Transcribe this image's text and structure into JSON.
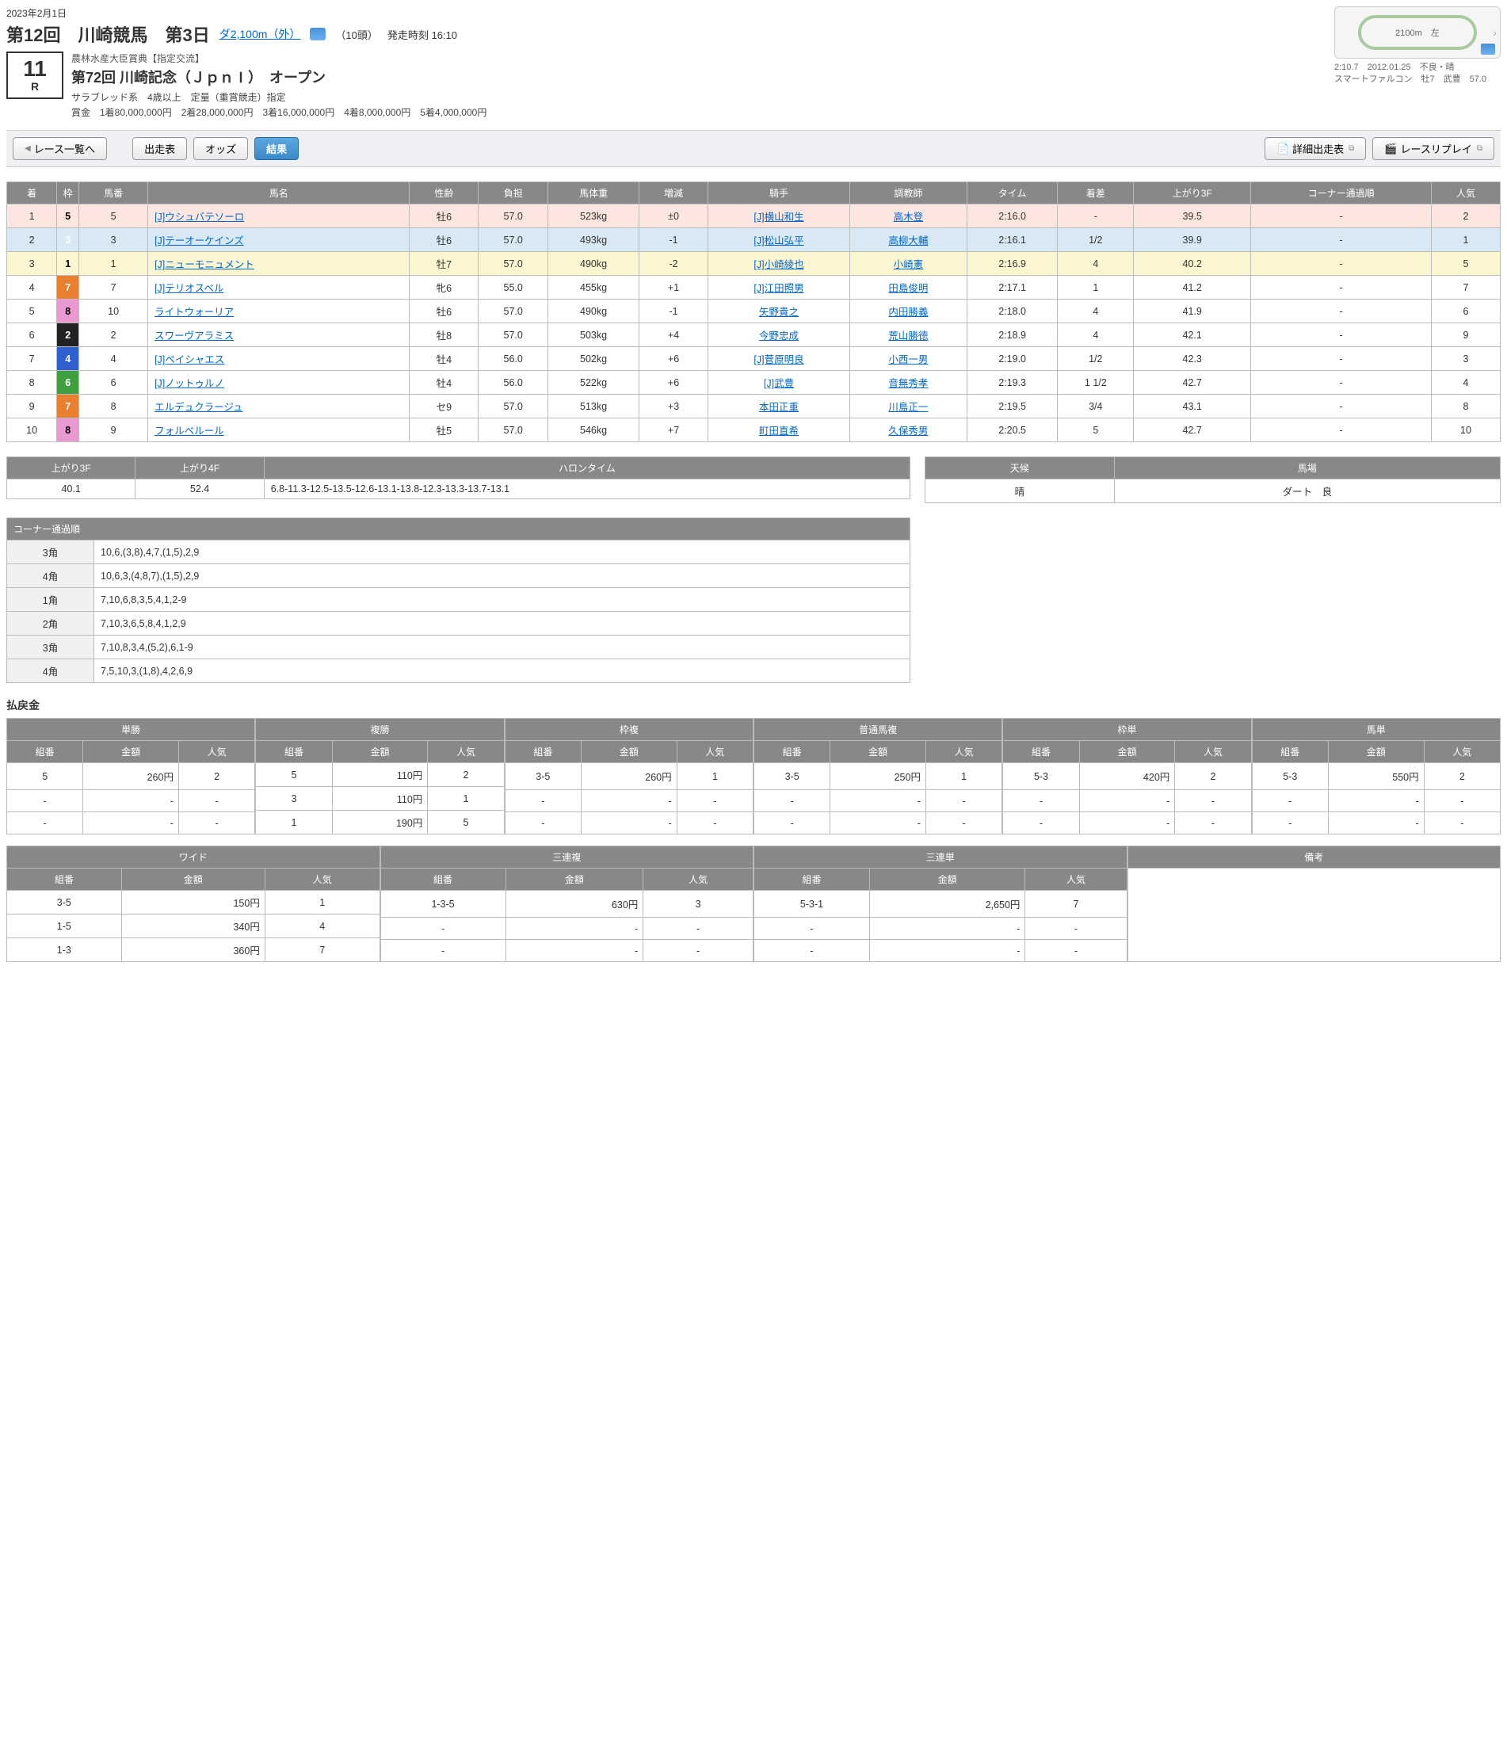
{
  "header": {
    "date": "2023年2月1日",
    "meeting": "第12回　川崎競馬　第3日",
    "course": "ダ2,100m（外）",
    "heads": "（10頭）",
    "start": "発走時刻 16:10",
    "race_no": "11",
    "race_r": "R",
    "subtitle": "農林水産大臣賞典【指定交流】",
    "race_name": "第72回 川崎記念（ＪｐｎⅠ）　オープン",
    "meta1": "サラブレッド系　4歳以上　定量（重賞競走）指定",
    "meta2": "賞金　1着80,000,000円　2着28,000,000円　3着16,000,000円　4着8,000,000円　5着4,000,000円",
    "track_label": "2100m　左",
    "rec1": "2:10.7　2012.01.25　不良・晴",
    "rec2": "スマートファルコン　牡7　武豊　57.0"
  },
  "nav": {
    "back": "レース一覧へ",
    "entry": "出走表",
    "odds": "オッズ",
    "result": "結果",
    "detail": "詳細出走表",
    "replay": "レースリプレイ"
  },
  "results": {
    "head": [
      "着",
      "枠",
      "馬番",
      "馬名",
      "性齢",
      "負担",
      "馬体重",
      "増減",
      "騎手",
      "調教師",
      "タイム",
      "着差",
      "上がり3F",
      "コーナー通過順",
      "人気"
    ],
    "rows": [
      {
        "p": "1",
        "waku": "5",
        "wc": "w5",
        "num": "5",
        "name": "[J]ウシュバテソーロ",
        "sa": "牡6",
        "wt": "57.0",
        "bw": "523kg",
        "delta": "±0",
        "jk": "[J]横山和生",
        "tr": "高木登",
        "time": "2:16.0",
        "gap": "-",
        "u3f": "39.5",
        "corner": "-",
        "pop": "2",
        "nl": 1,
        "jl": 1,
        "tl": 1
      },
      {
        "p": "2",
        "waku": "3",
        "wc": "w3",
        "num": "3",
        "name": "[J]テーオーケインズ",
        "sa": "牡6",
        "wt": "57.0",
        "bw": "493kg",
        "delta": "-1",
        "jk": "[J]松山弘平",
        "tr": "高柳大輔",
        "time": "2:16.1",
        "gap": "1/2",
        "u3f": "39.9",
        "corner": "-",
        "pop": "1",
        "nl": 1,
        "jl": 1,
        "tl": 1
      },
      {
        "p": "3",
        "waku": "1",
        "wc": "w1",
        "num": "1",
        "name": "[J]ニューモニュメント",
        "sa": "牡7",
        "wt": "57.0",
        "bw": "490kg",
        "delta": "-2",
        "jk": "[J]小崎綾也",
        "tr": "小崎憲",
        "time": "2:16.9",
        "gap": "4",
        "u3f": "40.2",
        "corner": "-",
        "pop": "5",
        "nl": 1,
        "jl": 1,
        "tl": 1
      },
      {
        "p": "4",
        "waku": "7",
        "wc": "w7",
        "num": "7",
        "name": "[J]テリオスベル",
        "sa": "牝6",
        "wt": "55.0",
        "bw": "455kg",
        "delta": "+1",
        "jk": "[J]江田照男",
        "tr": "田島俊明",
        "time": "2:17.1",
        "gap": "1",
        "u3f": "41.2",
        "corner": "-",
        "pop": "7",
        "nl": 1,
        "jl": 1,
        "tl": 1
      },
      {
        "p": "5",
        "waku": "8",
        "wc": "w8",
        "num": "10",
        "name": "ライトウォーリア",
        "sa": "牡6",
        "wt": "57.0",
        "bw": "490kg",
        "delta": "-1",
        "jk": "矢野貴之",
        "tr": "内田勝義",
        "time": "2:18.0",
        "gap": "4",
        "u3f": "41.9",
        "corner": "-",
        "pop": "6",
        "nl": 1,
        "jl": 1,
        "tl": 1
      },
      {
        "p": "6",
        "waku": "2",
        "wc": "w2",
        "num": "2",
        "name": "スワーヴアラミス",
        "sa": "牡8",
        "wt": "57.0",
        "bw": "503kg",
        "delta": "+4",
        "jk": "今野忠成",
        "tr": "荒山勝徳",
        "time": "2:18.9",
        "gap": "4",
        "u3f": "42.1",
        "corner": "-",
        "pop": "9",
        "nl": 1,
        "jl": 1,
        "tl": 1
      },
      {
        "p": "7",
        "waku": "4",
        "wc": "w4",
        "num": "4",
        "name": "[J]ペイシャエス",
        "sa": "牡4",
        "wt": "56.0",
        "bw": "502kg",
        "delta": "+6",
        "jk": "[J]菅原明良",
        "tr": "小西一男",
        "time": "2:19.0",
        "gap": "1/2",
        "u3f": "42.3",
        "corner": "-",
        "pop": "3",
        "nl": 1,
        "jl": 1,
        "tl": 1
      },
      {
        "p": "8",
        "waku": "6",
        "wc": "w6",
        "num": "6",
        "name": "[J]ノットゥルノ",
        "sa": "牡4",
        "wt": "56.0",
        "bw": "522kg",
        "delta": "+6",
        "jk": "[J]武豊",
        "tr": "音無秀孝",
        "time": "2:19.3",
        "gap": "1 1/2",
        "u3f": "42.7",
        "corner": "-",
        "pop": "4",
        "nl": 1,
        "jl": 1,
        "tl": 1
      },
      {
        "p": "9",
        "waku": "7",
        "wc": "w7",
        "num": "8",
        "name": "エルデュクラージュ",
        "sa": "セ9",
        "wt": "57.0",
        "bw": "513kg",
        "delta": "+3",
        "jk": "本田正重",
        "tr": "川島正一",
        "time": "2:19.5",
        "gap": "3/4",
        "u3f": "43.1",
        "corner": "-",
        "pop": "8",
        "nl": 1,
        "jl": 1,
        "tl": 1
      },
      {
        "p": "10",
        "waku": "8",
        "wc": "w8",
        "num": "9",
        "name": "フォルベルール",
        "sa": "牡5",
        "wt": "57.0",
        "bw": "546kg",
        "delta": "+7",
        "jk": "町田直希",
        "tr": "久保秀男",
        "time": "2:20.5",
        "gap": "5",
        "u3f": "42.7",
        "corner": "-",
        "pop": "10",
        "nl": 1,
        "jl": 1,
        "tl": 1
      }
    ]
  },
  "halon": {
    "head": [
      "上がり3F",
      "上がり4F",
      "ハロンタイム"
    ],
    "u3f": "40.1",
    "u4f": "52.4",
    "times": "6.8-11.3-12.5-13.5-12.6-13.1-13.8-12.3-13.3-13.7-13.1"
  },
  "cond": {
    "head": [
      "天候",
      "馬場"
    ],
    "weather": "晴",
    "track": "ダート　良"
  },
  "corners": {
    "title": "コーナー通過順",
    "rows": [
      {
        "c": "3角",
        "v": "10,6,(3,8),4,7,(1,5),2,9"
      },
      {
        "c": "4角",
        "v": "10,6,3,(4,8,7),(1,5),2,9"
      },
      {
        "c": "1角",
        "v": "7,10,6,8,3,5,4,1,2-9"
      },
      {
        "c": "2角",
        "v": "7,10,3,6,5,8,4,1,2,9"
      },
      {
        "c": "3角",
        "v": "7,10,8,3,4,(5,2),6,1-9"
      },
      {
        "c": "4角",
        "v": "7,5,10,3,(1,8),4,2,6,9"
      }
    ]
  },
  "payout_title": "払戻金",
  "payout_sub": [
    "組番",
    "金額",
    "人気"
  ],
  "payouts1": [
    {
      "cat": "単勝",
      "rows": [
        [
          "5",
          "260円",
          "2"
        ],
        [
          "-",
          "-",
          "-"
        ],
        [
          "-",
          "-",
          "-"
        ]
      ]
    },
    {
      "cat": "複勝",
      "rows": [
        [
          "5",
          "110円",
          "2"
        ],
        [
          "3",
          "110円",
          "1"
        ],
        [
          "1",
          "190円",
          "5"
        ]
      ]
    },
    {
      "cat": "枠複",
      "rows": [
        [
          "3-5",
          "260円",
          "1"
        ],
        [
          "-",
          "-",
          "-"
        ],
        [
          "-",
          "-",
          "-"
        ]
      ]
    },
    {
      "cat": "普通馬複",
      "rows": [
        [
          "3-5",
          "250円",
          "1"
        ],
        [
          "-",
          "-",
          "-"
        ],
        [
          "-",
          "-",
          "-"
        ]
      ]
    },
    {
      "cat": "枠単",
      "rows": [
        [
          "5-3",
          "420円",
          "2"
        ],
        [
          "-",
          "-",
          "-"
        ],
        [
          "-",
          "-",
          "-"
        ]
      ]
    },
    {
      "cat": "馬単",
      "rows": [
        [
          "5-3",
          "550円",
          "2"
        ],
        [
          "-",
          "-",
          "-"
        ],
        [
          "-",
          "-",
          "-"
        ]
      ]
    }
  ],
  "payouts2": [
    {
      "cat": "ワイド",
      "rows": [
        [
          "3-5",
          "150円",
          "1"
        ],
        [
          "1-5",
          "340円",
          "4"
        ],
        [
          "1-3",
          "360円",
          "7"
        ]
      ]
    },
    {
      "cat": "三連複",
      "rows": [
        [
          "1-3-5",
          "630円",
          "3"
        ],
        [
          "-",
          "-",
          "-"
        ],
        [
          "-",
          "-",
          "-"
        ]
      ]
    },
    {
      "cat": "三連単",
      "rows": [
        [
          "5-3-1",
          "2,650円",
          "7"
        ],
        [
          "-",
          "-",
          "-"
        ],
        [
          "-",
          "-",
          "-"
        ]
      ]
    },
    {
      "cat": "備考",
      "rows": [
        [
          "",
          "",
          ""
        ],
        [
          "",
          "",
          ""
        ],
        [
          "",
          "",
          ""
        ]
      ],
      "remarks": true
    }
  ]
}
